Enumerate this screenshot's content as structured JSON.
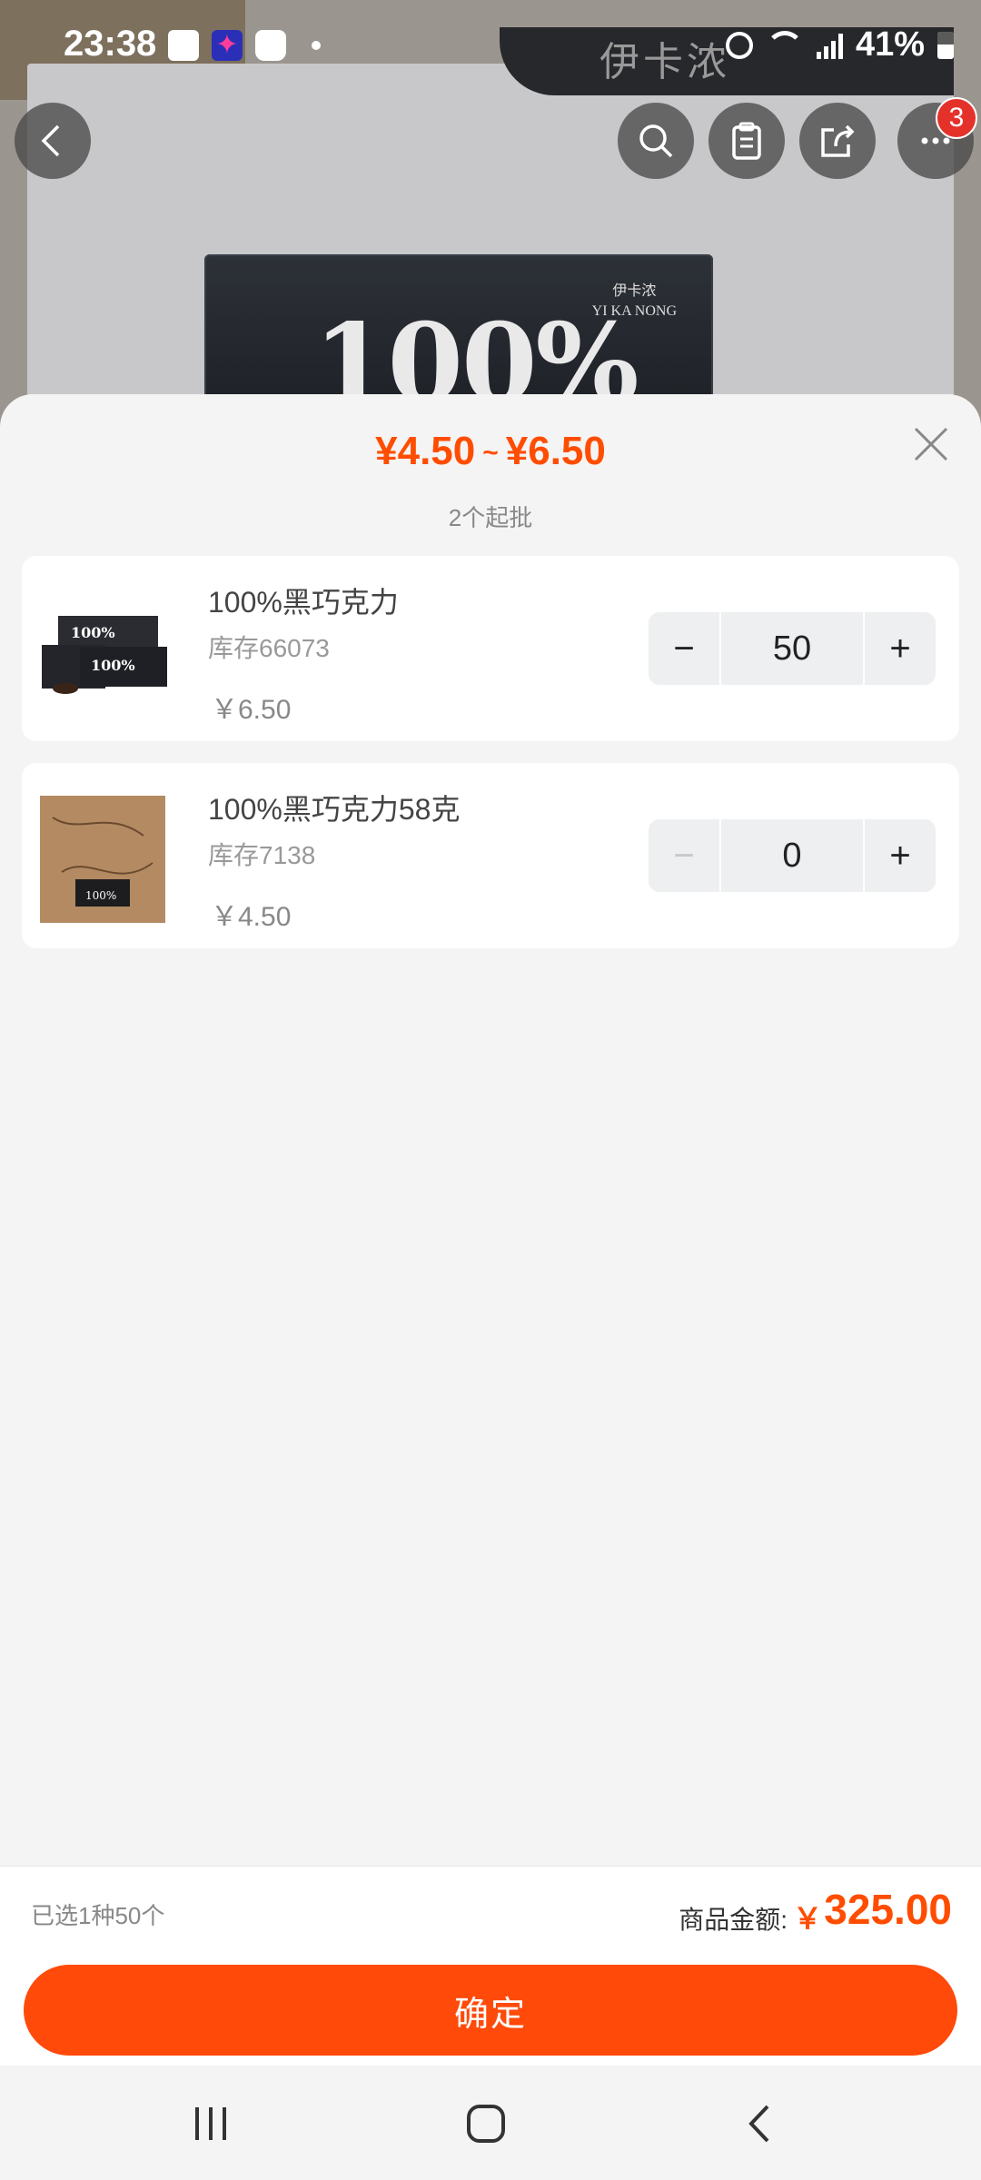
{
  "status_bar": {
    "time": "23:38",
    "battery": "41%"
  },
  "background": {
    "box_text": "100%",
    "brand_cn": "伊卡浓",
    "brand_en": "YI KA NONG",
    "top_banner": "伊卡浓"
  },
  "nav": {
    "cart_badge": "3"
  },
  "sheet": {
    "price_low": "¥4.50",
    "price_sep": "~",
    "price_high": "¥6.50",
    "min_order": "2个起批",
    "items": [
      {
        "name": "100%黑巧克力",
        "stock": "库存66073",
        "price": "￥6.50",
        "quantity": "50",
        "thumb_label": "100%"
      },
      {
        "name": "100%黑巧克力58克",
        "stock": "库存7138",
        "price": "￥4.50",
        "quantity": "0",
        "thumb_label": "100%"
      }
    ]
  },
  "footer": {
    "selected": "已选1种50个",
    "total_label": "商品金额:",
    "currency": "￥",
    "total": "325.00",
    "confirm": "确定"
  },
  "colors": {
    "accent": "#ff4a0a",
    "price": "#ff4d00"
  }
}
